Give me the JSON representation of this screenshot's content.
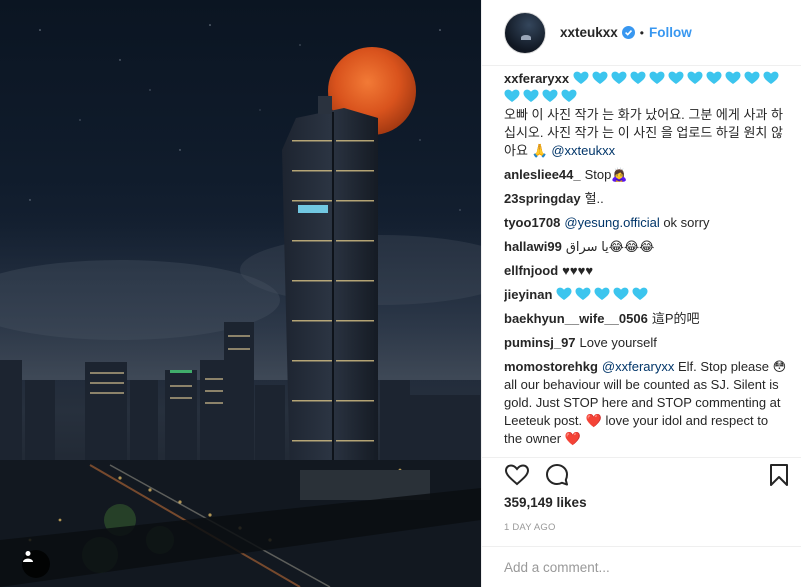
{
  "post": {
    "username": "xxteukxx",
    "follow_label": "Follow",
    "dot": "•",
    "likes": "359,149 likes",
    "time": "1 DAY AGO",
    "add_comment_placeholder": "Add a comment..."
  },
  "comments": [
    {
      "user": "xxferaryxx",
      "text": "",
      "blue_hearts": 15,
      "text_after": "오빠 이 사진 작가 는 화가 났어요. 그분 에게 사과 하십시오. 사진 작가 는 이 사진 을 업로드 하길 원치 않아요 🙏 ",
      "mention": "@xxteukxx"
    },
    {
      "user": "anlesliee44_",
      "text": "Stop🙇‍♀️"
    },
    {
      "user": "23springday",
      "text": "헐.."
    },
    {
      "user": "tyoo1708",
      "mention": "@yesung.official",
      "text": " ok sorry"
    },
    {
      "user": "hallawi99",
      "text": "يا سراق😂😂😂"
    },
    {
      "user": "ellfnjood",
      "text": "♥♥♥♥"
    },
    {
      "user": "jieyinan",
      "blue_hearts": 5,
      "text": ""
    },
    {
      "user": "baekhyun__wife__0506",
      "text": "這P的吧"
    },
    {
      "user": "puminsj_97",
      "text": "Love yourself"
    },
    {
      "user": "momostorehkg",
      "mention": "@xxferaryxx",
      "text": " Elf. Stop please 😳 all our behaviour will be counted as SJ. Silent is gold. Just STOP here and STOP commenting at Leeteuk post. ❤️ love your idol and respect to the owner ❤️"
    }
  ],
  "icons": {
    "like": "heart-outline-icon",
    "comment": "speech-bubble-icon",
    "save": "bookmark-icon",
    "verified": "verified-badge-icon",
    "user_tag": "user-tag-icon"
  },
  "colors": {
    "link_blue": "#3897f0",
    "mention": "#003569",
    "moon": "#e0571f",
    "heart_blue": "#3cc5ee"
  }
}
